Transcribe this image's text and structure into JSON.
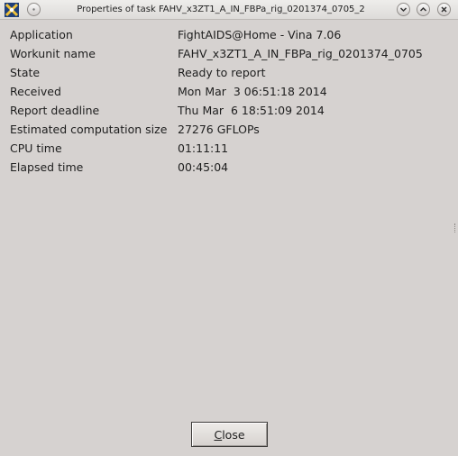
{
  "window": {
    "title": "Properties of task FAHV_x3ZT1_A_IN_FBPa_rig_0201374_0705_2",
    "icon": "boinc-app-icon",
    "controls": [
      "minimize-icon",
      "maximize-icon",
      "close-icon"
    ]
  },
  "properties": [
    {
      "label": "Application",
      "value": "FightAIDS@Home - Vina 7.06"
    },
    {
      "label": "Workunit name",
      "value": "FAHV_x3ZT1_A_IN_FBPa_rig_0201374_0705"
    },
    {
      "label": "State",
      "value": "Ready to report"
    },
    {
      "label": "Received",
      "value": "Mon Mar  3 06:51:18 2014"
    },
    {
      "label": "Report deadline",
      "value": "Thu Mar  6 18:51:09 2014"
    },
    {
      "label": "Estimated computation size",
      "value": "27276 GFLOPs"
    },
    {
      "label": "CPU time",
      "value": "01:11:11"
    },
    {
      "label": "Elapsed time",
      "value": "00:45:04"
    }
  ],
  "buttons": {
    "close_mnemonic": "C",
    "close_rest": "lose"
  }
}
